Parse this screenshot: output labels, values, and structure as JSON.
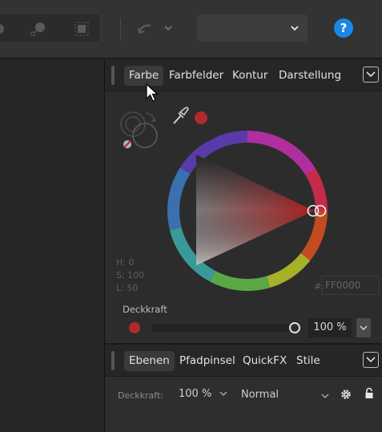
{
  "toolbar": {
    "tools": [
      "select-mode-icon",
      "node-tool-icon",
      "transform-box-icon"
    ],
    "undo_icon": "undo-arrow-icon",
    "dropdown_value": "",
    "help_label": "?"
  },
  "color_panel": {
    "tabs": [
      "Farbe",
      "Farbfelder",
      "Kontur",
      "Darstellung"
    ],
    "active_tab": "Farbe",
    "hsl": {
      "h": "H: 0",
      "s": "S: 100",
      "l": "L: 50"
    },
    "hex_prefix": "#:",
    "hex_value": "FF0000",
    "current_color": "#b12a2a",
    "opacity_label": "Deckkraft",
    "opacity_value": "100 %",
    "opacity_level": 1.0
  },
  "layers_panel": {
    "tabs": [
      "Ebenen",
      "Pfadpinsel",
      "QuickFX",
      "Stile"
    ],
    "active_tab": "Ebenen",
    "opacity_label": "Deckkraft:",
    "opacity_value": "100 %",
    "blend_mode": "Normal"
  },
  "colors": {
    "accent": "#1a87e6",
    "panel": "#2e2e2e",
    "selected_red": "#b12a2a"
  }
}
